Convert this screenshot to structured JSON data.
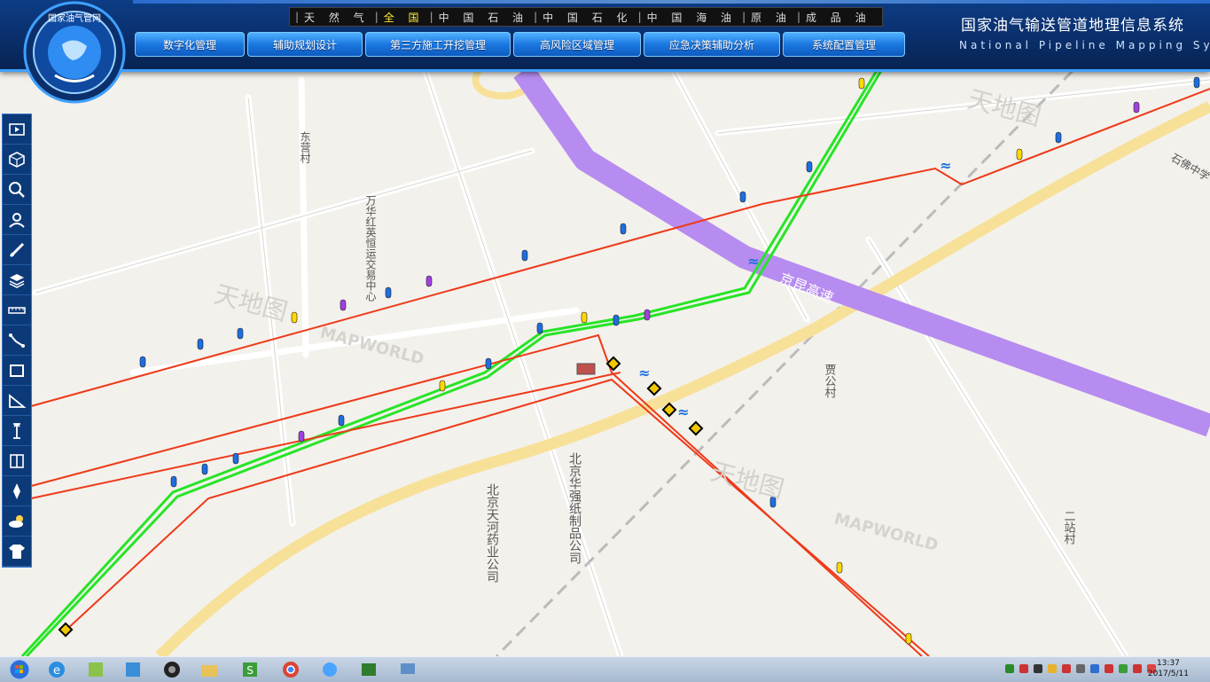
{
  "categories": [
    {
      "label": "天 然 气",
      "active": false
    },
    {
      "label": "全 国",
      "active": true
    },
    {
      "label": "中 国 石 油",
      "active": false
    },
    {
      "label": "中 国 石 化",
      "active": false
    },
    {
      "label": "中 国 海 油",
      "active": false
    },
    {
      "label": "原 油",
      "active": false
    },
    {
      "label": "成 品 油",
      "active": false
    }
  ],
  "menu": [
    {
      "label": "数字化管理"
    },
    {
      "label": "辅助规划设计"
    },
    {
      "label": "第三方施工开挖管理"
    },
    {
      "label": "高风险区域管理"
    },
    {
      "label": "应急决策辅助分析"
    },
    {
      "label": "系统配置管理"
    }
  ],
  "title": {
    "cn": "国家油气输送管道地理信息系统",
    "en": "National Pipeline Mapping System"
  },
  "logo_text": "国家油气管网",
  "toolbar": [
    "play-icon",
    "cube-icon",
    "search-icon",
    "user-icon",
    "pipe-icon",
    "layers-icon",
    "ruler-icon",
    "polyline-icon",
    "rectangle-icon",
    "angle-icon",
    "height-icon",
    "profile-icon",
    "compass-icon",
    "weather-icon",
    "shirt-icon"
  ],
  "map": {
    "labels": {
      "highway": "京昆高速",
      "village1": "东营村",
      "org1": "万华红英恒运交易中心",
      "org2": "北京华强纸制品公司",
      "org3": "北京天河药业公司",
      "village2": "贾公村",
      "village3": "二站村",
      "school": "石佛中学",
      "watermark": "天地图",
      "watermark_en": "MAPWORLD"
    }
  },
  "clock": {
    "time": "13:37",
    "date": "2017/5/11"
  },
  "colors": {
    "header": "#0a2f6b",
    "gas_pipeline": "#27e427",
    "oil_pipeline": "#ee3a1a",
    "highway": "#b78cf0",
    "road": "#f7e199"
  }
}
